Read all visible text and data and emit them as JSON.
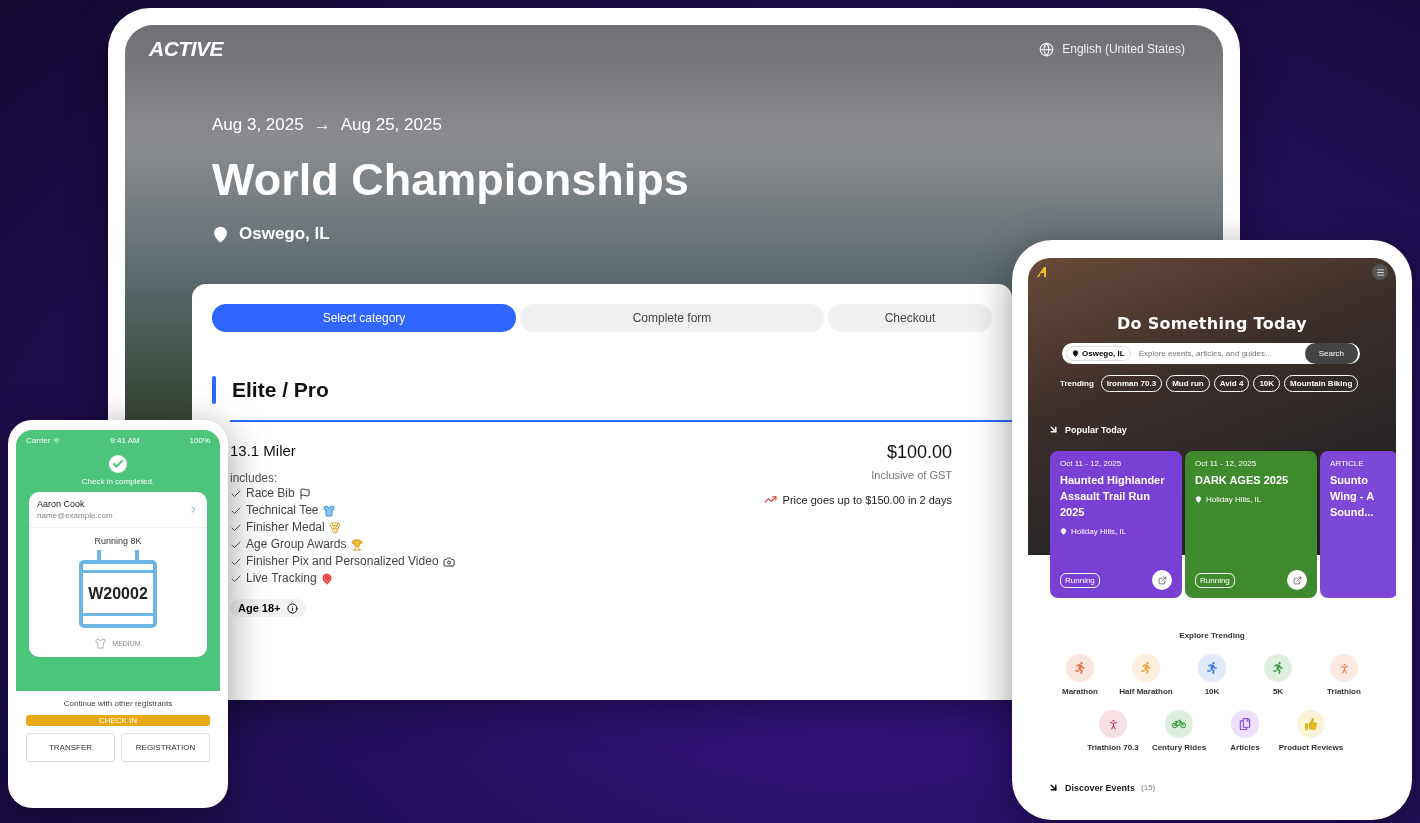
{
  "tablet": {
    "logo": "ACTIVE",
    "language": "English (United States)",
    "date_start": "Aug 3, 2025",
    "date_arrow": "→",
    "date_end": "Aug 25, 2025",
    "title": "World Championships",
    "location": "Oswego, IL",
    "steps": [
      {
        "label": "Select category",
        "selected": true
      },
      {
        "label": "Complete form",
        "selected": false
      },
      {
        "label": "Checkout",
        "selected": false
      }
    ],
    "category": "Elite / Pro",
    "item": {
      "name": "13.1 Miler",
      "includes_label": "includes:",
      "includes": [
        {
          "text": "Race Bib",
          "kind": "flag"
        },
        {
          "text": "Technical Tee",
          "kind": "shirt"
        },
        {
          "text": "Finisher Medal",
          "kind": "medal"
        },
        {
          "text": "Age Group Awards",
          "kind": "trophy"
        },
        {
          "text": "Finisher Pix and Personalized Video",
          "kind": "camera"
        },
        {
          "text": "Live Tracking",
          "kind": "pin"
        }
      ],
      "age": "Age 18+",
      "price": "$100.00",
      "tax_note": "Inclusive of GST",
      "price_alert": "Price goes up to $150.00 in 2 days"
    }
  },
  "checkin_phone": {
    "status_bar": {
      "carrier": "Carrier",
      "time": "9:41 AM",
      "battery": "100%"
    },
    "message": "Check in completed.",
    "name": "Aaron Cook",
    "email": "name@example.com",
    "event": "Running 8K",
    "bib": "W20002",
    "shirt_size": "MEDIUM",
    "continue_label": "Continue with other registrants",
    "buttons": [
      {
        "label": "CHECK IN",
        "kind": "primary"
      },
      {
        "label": "TRANSFER",
        "kind": "outline"
      },
      {
        "label": "REGISTRATION",
        "kind": "outline"
      }
    ]
  },
  "discover_phone": {
    "headline": "Do Something Today",
    "location": "Oswego, IL",
    "search_placeholder": "Explore events, articles, and guides...",
    "search_button": "Search",
    "trending_label": "Trending",
    "trending": [
      "Ironman 70.3",
      "Mud run",
      "Avid 4",
      "10K",
      "Mountain Biking"
    ],
    "popular_title": "Popular Today",
    "cards": [
      {
        "kind": "event",
        "date": "Oct 11 - 12, 2025",
        "title": "Haunted Highlander Assault Trail Run 2025",
        "location": "Holiday Hills, IL",
        "tag": "Running",
        "color": "#7a3fd4"
      },
      {
        "kind": "event",
        "date": "Oct 11 - 12, 2025",
        "title": "DARK AGES 2025",
        "location": "Holiday Hills, IL",
        "tag": "Running",
        "color": "#3f8a2c"
      },
      {
        "kind": "article",
        "label": "ARTICLE",
        "title": "Suunto Wing - A Sound...",
        "color": "#7d48d8"
      }
    ],
    "explore_title": "Explore Trending",
    "categories": [
      {
        "label": "Marathon",
        "kind": "runner",
        "color": "#e8663a"
      },
      {
        "label": "Half Marathon",
        "kind": "runner",
        "color": "#f0a030"
      },
      {
        "label": "10K",
        "kind": "runner",
        "color": "#3a78e0"
      },
      {
        "label": "5K",
        "kind": "runner",
        "color": "#3c9a44"
      },
      {
        "label": "Triathlon",
        "kind": "triathlon",
        "color": "#e8804a"
      },
      {
        "label": "Triathlon 70.3",
        "kind": "triathlon",
        "color": "#d0405a"
      },
      {
        "label": "Century Rides",
        "kind": "bike",
        "color": "#2e9a3a"
      },
      {
        "label": "Articles",
        "kind": "articles",
        "color": "#8a4ae0"
      },
      {
        "label": "Product Reviews",
        "kind": "thumbs",
        "color": "#e0b820"
      }
    ],
    "discover_title": "Discover Events",
    "discover_count": "(15)"
  }
}
